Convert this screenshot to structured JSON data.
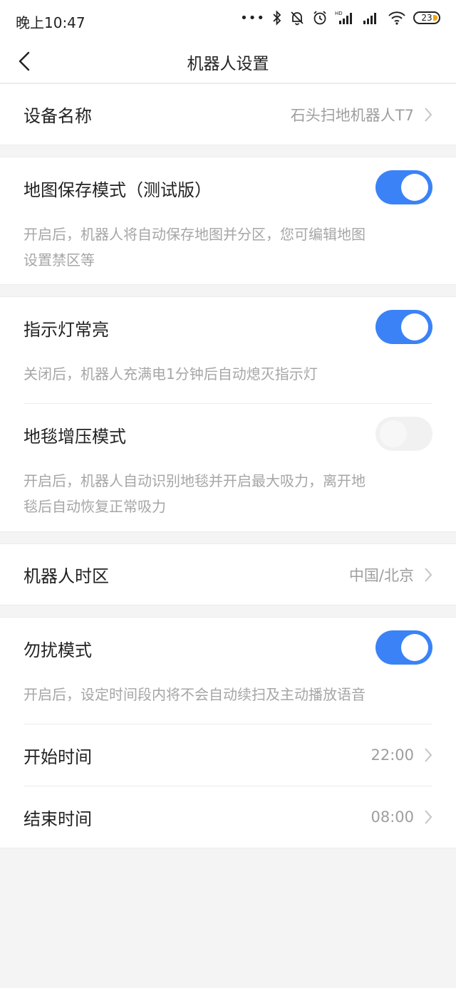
{
  "status_bar": {
    "time": "晚上10:47",
    "dots": "•••",
    "battery_level": "23",
    "hd_label": "HD",
    "icons": [
      "bluetooth-icon",
      "mute-bell-icon",
      "alarm-icon",
      "signal-hd-icon",
      "signal-icon",
      "wifi-icon",
      "battery-icon"
    ]
  },
  "header": {
    "title": "机器人设置"
  },
  "device": {
    "label": "设备名称",
    "value": "石头扫地机器人T7"
  },
  "map_save": {
    "label": "地图保存模式（测试版）",
    "enabled": true,
    "desc_line1": "开启后，机器人将自动保存地图并分区，您可编辑地图",
    "desc_line2": "设置禁区等"
  },
  "indicator": {
    "label": "指示灯常亮",
    "enabled": true,
    "desc": "关闭后，机器人充满电1分钟后自动熄灭指示灯"
  },
  "carpet": {
    "label": "地毯增压模式",
    "enabled": false,
    "desc_line1": "开启后，机器人自动识别地毯并开启最大吸力，离开地",
    "desc_line2": "毯后自动恢复正常吸力"
  },
  "timezone": {
    "label": "机器人时区",
    "value": "中国/北京"
  },
  "dnd": {
    "label": "勿扰模式",
    "enabled": true,
    "desc": "开启后，设定时间段内将不会自动续扫及主动播放语音",
    "start_label": "开始时间",
    "start_value": "22:00",
    "end_label": "结束时间",
    "end_value": "08:00"
  },
  "colors": {
    "accent": "#3b82f6",
    "background": "#f4f4f4"
  }
}
